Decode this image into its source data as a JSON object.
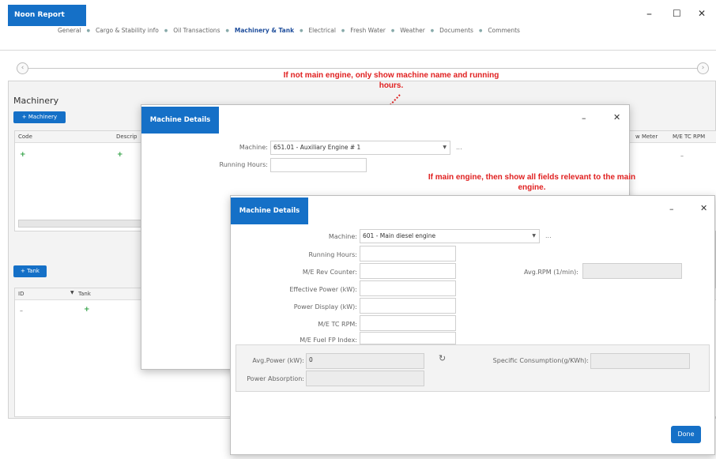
{
  "app": {
    "tab_title": "Noon Report"
  },
  "window_controls": {
    "minimize": "–",
    "maximize": "☐",
    "close": "✕"
  },
  "nav": {
    "items": [
      "General",
      "Cargo & Stability info",
      "Oil Transactions",
      "Machinery & Tank",
      "Electrical",
      "Fresh Water",
      "Weather",
      "Documents",
      "Comments"
    ],
    "active": "Machinery & Tank"
  },
  "machinery": {
    "title": "Machinery",
    "add_button": "+ Machinery",
    "columns": [
      "Code",
      "Descrip"
    ],
    "right_columns": [
      "w Meter",
      "M/E TC RPM"
    ],
    "row_add": "+",
    "row_dash": "–"
  },
  "tank": {
    "add_button": "+ Tank",
    "columns": [
      "ID",
      "Tank"
    ],
    "row_dash": "–",
    "row_add": "+"
  },
  "annotations": {
    "top": "If not main engine, only show machine name and running hours.",
    "mid": "If main engine, then show all fields relevant to the main engine."
  },
  "dialog1": {
    "title": "Machine Details",
    "machine_label": "Machine:",
    "machine_value": "651.01 - Auxiliary Engine # 1",
    "running_hours_label": "Running Hours:",
    "ellipsis": "..."
  },
  "dialog2": {
    "title": "Machine Details",
    "machine_label": "Machine:",
    "machine_value": "601 - Main diesel engine",
    "ellipsis": "...",
    "running_hours_label": "Running Hours:",
    "rev_counter_label": "M/E Rev Counter:",
    "effective_power_label": "Effective Power (kW):",
    "power_display_label": "Power Display (kW):",
    "tc_rpm_label": "M/E TC RPM:",
    "fuel_index_label": "M/E Fuel FP Index:",
    "avg_rpm_label": "Avg.RPM (1/min):",
    "avg_power_label": "Avg.Power (kW):",
    "avg_power_value": "0",
    "specific_consumption_label": "Specific Consumption(g/KWh):",
    "power_absorption_label": "Power Absorption:",
    "done_label": "Done"
  }
}
